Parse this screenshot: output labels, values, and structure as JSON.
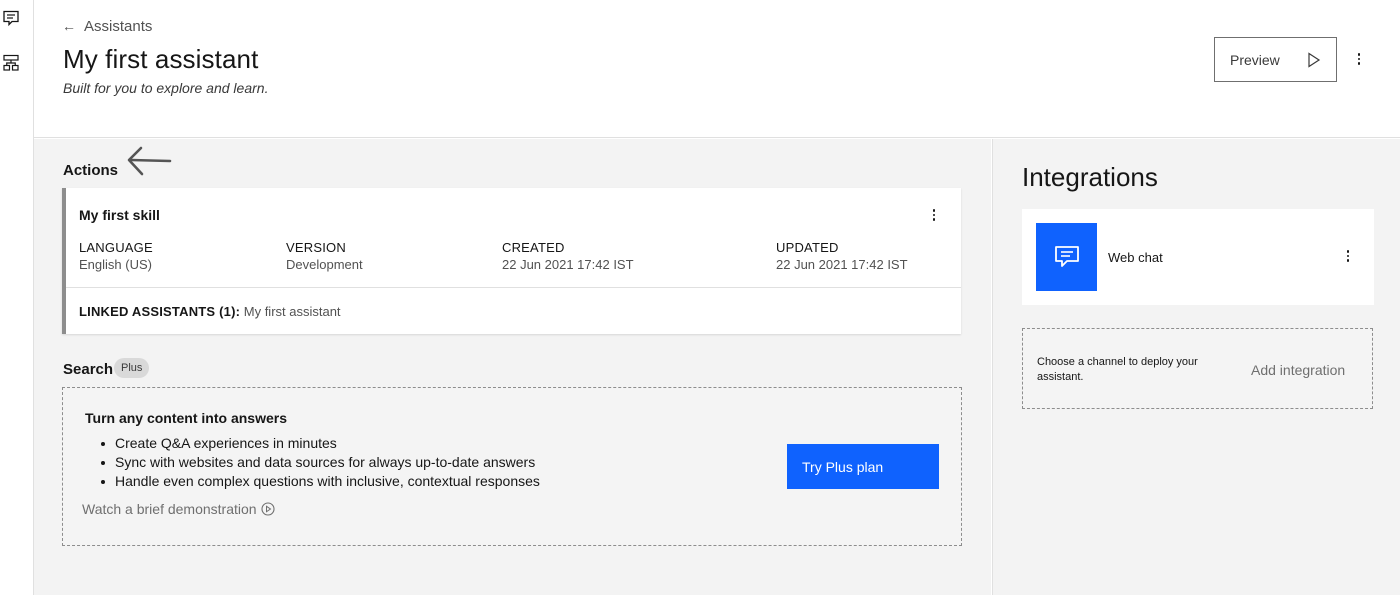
{
  "header": {
    "breadcrumb": "Assistants",
    "title": "My first assistant",
    "subtitle": "Built for you to explore and learn.",
    "preview_label": "Preview"
  },
  "actions": {
    "section_label": "Actions",
    "skill": {
      "name": "My first skill",
      "language_label": "LANGUAGE",
      "language_value": "English (US)",
      "version_label": "VERSION",
      "version_value": "Development",
      "created_label": "CREATED",
      "created_value": "22 Jun 2021 17:42 IST",
      "updated_label": "UPDATED",
      "updated_value": "22 Jun 2021 17:42 IST",
      "linked_label": "LINKED ASSISTANTS (1):",
      "linked_value": "My first assistant"
    }
  },
  "search": {
    "section_label": "Search",
    "tag": "Plus",
    "heading": "Turn any content into answers",
    "bullets": [
      "Create Q&A experiences in minutes",
      "Sync with websites and data sources for always up-to-date answers",
      "Handle even complex questions with inclusive, contextual responses"
    ],
    "watch_link": "Watch a brief demonstration",
    "cta": "Try Plus plan"
  },
  "integrations": {
    "title": "Integrations",
    "items": [
      {
        "name": "Web chat",
        "icon": "chat-bubble-icon",
        "tile_color": "#0f62fe"
      }
    ],
    "add_hint": "Choose a channel to deploy your assistant.",
    "add_label": "Add integration"
  },
  "colors": {
    "accent": "#0f62fe",
    "panel_bg": "#f3f3f3"
  }
}
